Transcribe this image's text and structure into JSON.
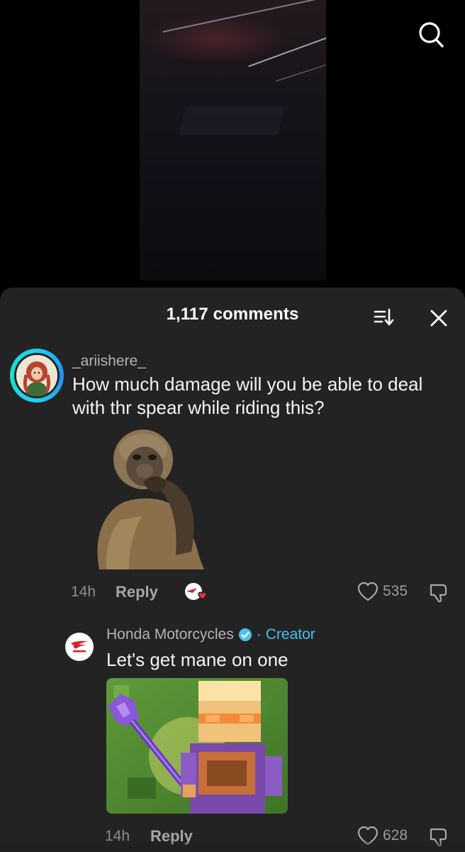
{
  "header": {
    "search_icon": "search-icon"
  },
  "comments_panel": {
    "title": "1,117 comments",
    "sort_icon": "sort-icon",
    "close_icon": "close-icon"
  },
  "comments": [
    {
      "username": "_ariishere_",
      "text": "How much damage will you be able to deal with thr spear while riding this?",
      "sticker": "thinking-monkey",
      "time": "14h",
      "reply_label": "Reply",
      "likes": "535"
    }
  ],
  "replies": [
    {
      "author": "Honda Motorcycles",
      "verified": true,
      "separator": "·",
      "badge": "Creator",
      "text": "Let's get mane on one",
      "image": "minecraft-character-with-spear",
      "time": "14h",
      "reply_label": "Reply",
      "likes": "628"
    }
  ],
  "colors": {
    "sheet_bg": "#232323",
    "creator_blue": "#3ec2f2",
    "like_red": "#e8304b"
  }
}
